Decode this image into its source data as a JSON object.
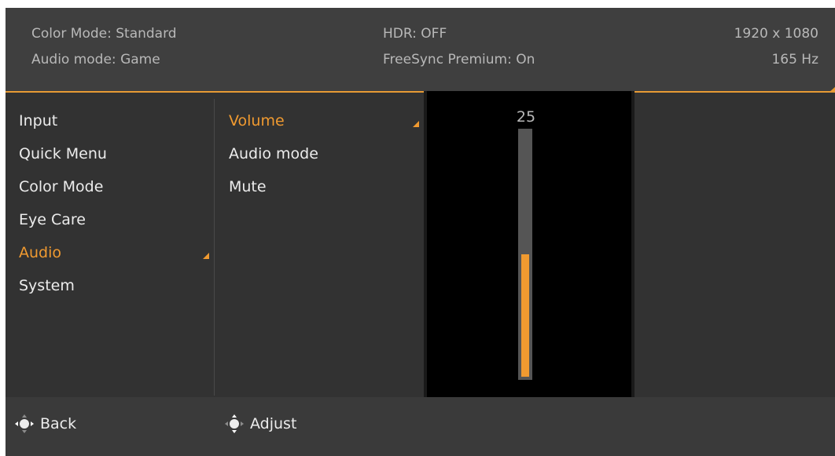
{
  "status": {
    "color_mode": "Color Mode: Standard",
    "audio_mode": "Audio mode: Game",
    "hdr": "HDR: OFF",
    "freesync": "FreeSync Premium: On",
    "resolution": "1920 x 1080",
    "refresh_rate": "165 Hz"
  },
  "menu": {
    "items": [
      {
        "label": "Input"
      },
      {
        "label": "Quick Menu"
      },
      {
        "label": "Color Mode"
      },
      {
        "label": "Eye Care"
      },
      {
        "label": "Audio",
        "active": true
      },
      {
        "label": "System"
      }
    ]
  },
  "submenu": {
    "items": [
      {
        "label": "Volume",
        "active": true
      },
      {
        "label": "Audio mode"
      },
      {
        "label": "Mute"
      }
    ]
  },
  "volume": {
    "value": "25",
    "level_percent": 50
  },
  "footer": {
    "back_label": "Back",
    "adjust_label": "Adjust"
  },
  "colors": {
    "accent": "#f09a30",
    "panel_bg": "#323232",
    "header_bg": "#3f3f3f",
    "text": "#ececec"
  },
  "icons": [
    "joystick-left-right-icon",
    "joystick-up-down-icon",
    "selection-triangle-icon"
  ]
}
